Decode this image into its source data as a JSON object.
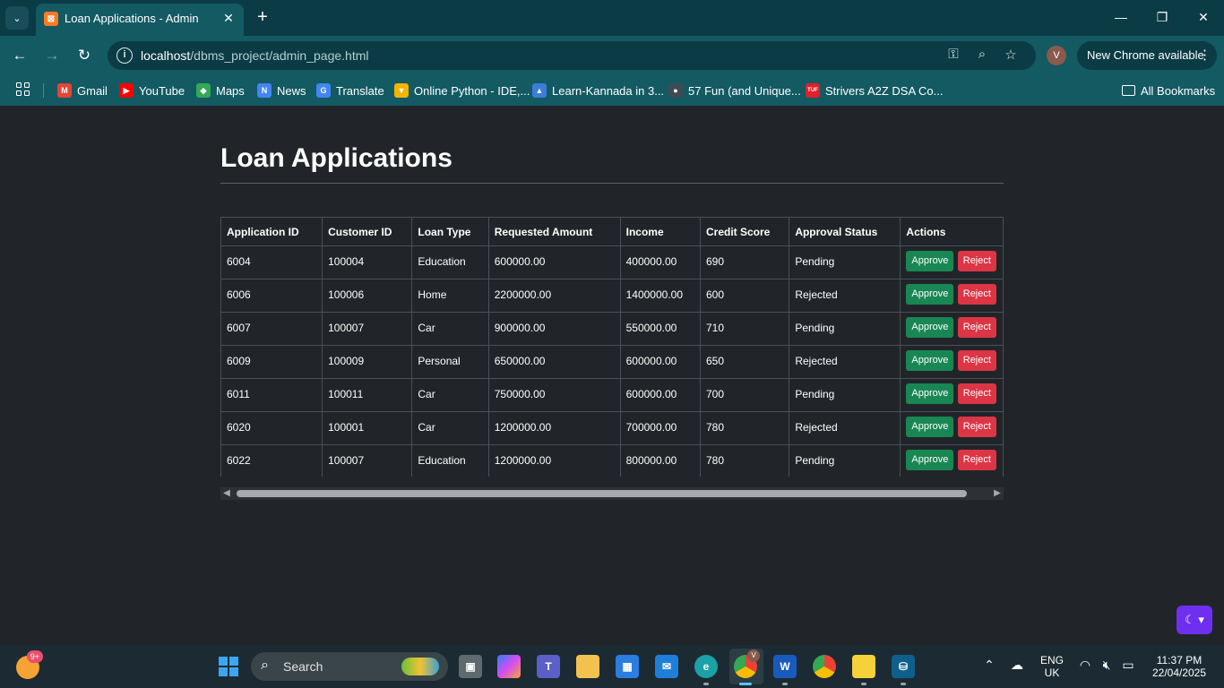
{
  "browser": {
    "tab_title": "Loan Applications - Admin",
    "tab_favicon": "xampp-icon",
    "url_host": "localhost",
    "url_path": "/dbms_project/admin_page.html",
    "profile_initial": "V",
    "update_label": "New Chrome available",
    "bookmarks": [
      {
        "label": "Gmail",
        "icon_color": "#ea4335",
        "icon_char": "M"
      },
      {
        "label": "YouTube",
        "icon_color": "#ff0000",
        "icon_char": "▶"
      },
      {
        "label": "Maps",
        "icon_color": "#34a853",
        "icon_char": "◆"
      },
      {
        "label": "News",
        "icon_color": "#4285f4",
        "icon_char": "N"
      },
      {
        "label": "Translate",
        "icon_color": "#4285f4",
        "icon_char": "G"
      },
      {
        "label": "Online Python - IDE,...",
        "icon_color": "#f4b400",
        "icon_char": "▼"
      },
      {
        "label": "Learn-Kannada in 3...",
        "icon_color": "#3b7dd8",
        "icon_char": "▲"
      },
      {
        "label": "57 Fun (and Unique...",
        "icon_color": "#3f4a55",
        "icon_char": "●"
      },
      {
        "label": "Strivers A2Z DSA Co...",
        "icon_color": "#e0202c",
        "icon_char": "TUF"
      }
    ],
    "all_bookmarks_label": "All Bookmarks"
  },
  "page": {
    "title": "Loan Applications",
    "columns": [
      "Application ID",
      "Customer ID",
      "Loan Type",
      "Requested Amount",
      "Income",
      "Credit Score",
      "Approval Status",
      "Actions"
    ],
    "approve_label": "Approve",
    "reject_label": "Reject",
    "rows": [
      [
        "6004",
        "100004",
        "Education",
        "600000.00",
        "400000.00",
        "690",
        "Pending"
      ],
      [
        "6006",
        "100006",
        "Home",
        "2200000.00",
        "1400000.00",
        "600",
        "Rejected"
      ],
      [
        "6007",
        "100007",
        "Car",
        "900000.00",
        "550000.00",
        "710",
        "Pending"
      ],
      [
        "6009",
        "100009",
        "Personal",
        "650000.00",
        "600000.00",
        "650",
        "Rejected"
      ],
      [
        "6011",
        "100011",
        "Car",
        "750000.00",
        "600000.00",
        "700",
        "Pending"
      ],
      [
        "6020",
        "100001",
        "Car",
        "1200000.00",
        "700000.00",
        "780",
        "Rejected"
      ],
      [
        "6022",
        "100007",
        "Education",
        "1200000.00",
        "800000.00",
        "780",
        "Pending"
      ]
    ],
    "colors": {
      "approve": "#198754",
      "reject": "#dc3545",
      "background": "#212529",
      "theme_toggle": "#6f2ff0"
    }
  },
  "taskbar": {
    "weather_badge": "9+",
    "search_label": "Search",
    "language_line1": "ENG",
    "language_line2": "UK",
    "time": "11:37 PM",
    "date": "22/04/2025",
    "chrome_profile_badge": "V"
  }
}
